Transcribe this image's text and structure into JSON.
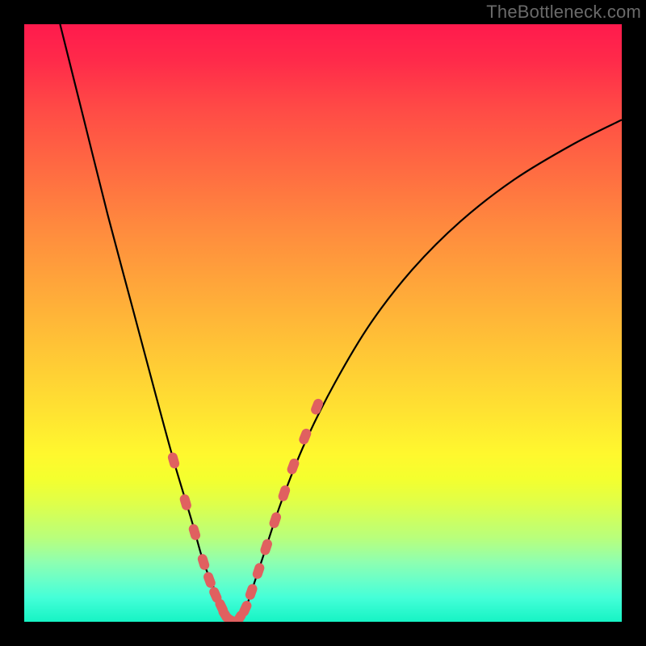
{
  "watermark": "TheBottleneck.com",
  "chart_data": {
    "type": "line",
    "title": "",
    "xlabel": "",
    "ylabel": "",
    "xlim": [
      0,
      100
    ],
    "ylim": [
      0,
      100
    ],
    "grid": false,
    "legend": false,
    "series": [
      {
        "name": "bottleneck-curve",
        "x": [
          6,
          10,
          14,
          18,
          22,
          25,
          28,
          30,
          32,
          33,
          34,
          35,
          36,
          37,
          38,
          40,
          43,
          47,
          52,
          58,
          65,
          73,
          82,
          92,
          100
        ],
        "y": [
          100,
          84,
          68,
          53,
          38,
          27,
          17,
          10,
          5,
          2,
          0,
          0,
          0,
          2,
          5,
          11,
          20,
          30,
          40,
          50,
          59,
          67,
          74,
          80,
          84
        ]
      }
    ],
    "markers": [
      {
        "name": "left-arm-markers",
        "x": [
          25,
          27,
          28.5,
          30,
          31,
          32,
          33,
          33.6,
          34.3,
          35
        ],
        "y": [
          27,
          20,
          15,
          10,
          7,
          4.5,
          2.5,
          1.2,
          0.4,
          0
        ]
      },
      {
        "name": "right-arm-markers",
        "x": [
          36,
          37,
          38,
          39.2,
          40.5,
          42,
          43.5,
          45,
          47,
          49
        ],
        "y": [
          0.6,
          2.2,
          5,
          8.5,
          12.5,
          17,
          21.5,
          26,
          31,
          36
        ]
      }
    ],
    "colors": {
      "curve": "#000000",
      "marker": "#e06060",
      "gradient_top": "#ff1a4d",
      "gradient_bottom": "#16f3c4"
    }
  }
}
